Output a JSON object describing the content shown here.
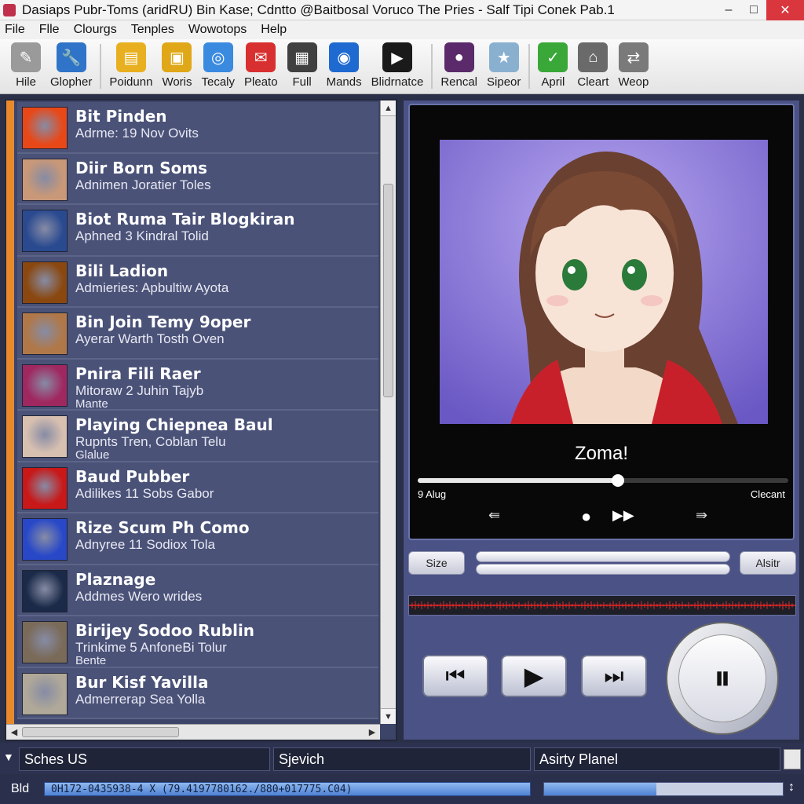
{
  "window": {
    "title": "Dasiaps Pubr-Toms (aridRU) Bin Kase; Cdntto @Baitbosal Voruco The Pries - Salf Tipi Conek Pab.1",
    "minimize_glyph": "–",
    "maximize_glyph": "□",
    "close_glyph": "✕"
  },
  "menu": [
    "File",
    "Flle",
    "Clourgs",
    "Tenples",
    "Wowotops",
    "Help"
  ],
  "toolbar": [
    {
      "label": "Hile",
      "icon": "satellite-icon",
      "color": "#9a9a9a",
      "glyph": "✎"
    },
    {
      "label": "Glopher",
      "icon": "wrench-icon",
      "color": "#2f74c8",
      "glyph": "🔧"
    },
    {
      "label": "Poidunn",
      "icon": "document-icon",
      "color": "#e8b020",
      "glyph": "▤"
    },
    {
      "label": "Woris",
      "icon": "folder-icon",
      "color": "#e0a818",
      "glyph": "▣"
    },
    {
      "label": "Tecaly",
      "icon": "compass-icon",
      "color": "#3a8ae0",
      "glyph": "◎"
    },
    {
      "label": "Pleato",
      "icon": "mail-icon",
      "color": "#d83030",
      "glyph": "✉"
    },
    {
      "label": "Full",
      "icon": "film-icon",
      "color": "#404040",
      "glyph": "▦"
    },
    {
      "label": "Mands",
      "icon": "globe-icon",
      "color": "#1e6ad0",
      "glyph": "◉"
    },
    {
      "label": "Blidrnatce",
      "icon": "play-store-icon",
      "color": "#1a1a1a",
      "glyph": "▶"
    },
    {
      "label": "Rencal",
      "icon": "disc-icon",
      "color": "#5a2a6a",
      "glyph": "●"
    },
    {
      "label": "Sipeor",
      "icon": "badge-icon",
      "color": "#8ab0d0",
      "glyph": "★"
    },
    {
      "label": "April",
      "icon": "check-icon",
      "color": "#3aa838",
      "glyph": "✓"
    },
    {
      "label": "Cleart",
      "icon": "home-icon",
      "color": "#6a6a6a",
      "glyph": "⌂"
    },
    {
      "label": "Weop",
      "icon": "swap-icon",
      "color": "#7a7a7a",
      "glyph": "⇄"
    }
  ],
  "playlist": [
    {
      "title": "Bit Pinden",
      "sub": "Adrme: 19 Nov Ovits",
      "sub2": "",
      "thumb": "#e84818"
    },
    {
      "title": "Diir Born Soms",
      "sub": "Adnimen Joratier Toles",
      "sub2": "",
      "thumb": "#c89878"
    },
    {
      "title": "Biot Ruma Tair Blogkiran",
      "sub": "Aphned 3 Kindral Tolid",
      "sub2": "",
      "thumb": "#2a4a90"
    },
    {
      "title": "Bili Ladion",
      "sub": "Admieries: Apbultiw Ayota",
      "sub2": "",
      "thumb": "#8a4810"
    },
    {
      "title": "Bin Join Temy 9oper",
      "sub": "Ayerar Warth Tosth Oven",
      "sub2": "",
      "thumb": "#b07848"
    },
    {
      "title": "Pnira Fili Raer",
      "sub": "Mitoraw 2 Juhin Tajyb",
      "sub2": "Mante",
      "thumb": "#a02860"
    },
    {
      "title": "Playing Chiepnea Baul",
      "sub": "Rupnts Tren, Coblan Telu",
      "sub2": "Glalue",
      "thumb": "#d8c0b0"
    },
    {
      "title": "Baud Pubber",
      "sub": "Adilikes 11 Sobs Gabor",
      "sub2": "",
      "thumb": "#c81818"
    },
    {
      "title": "Rize Scum Ph Como",
      "sub": "Adnyree 11 Sodiox Tola",
      "sub2": "",
      "thumb": "#2848c8"
    },
    {
      "title": "Plaznage",
      "sub": "Addmes Wero wrides",
      "sub2": "",
      "thumb": "#1a2a48"
    },
    {
      "title": "Birijey Sodoo Rublin",
      "sub": "Trinkime 5 AnfoneBi Tolur",
      "sub2": "Bente",
      "thumb": "#7a6a58"
    },
    {
      "title": "Bur Kisf Yavilla",
      "sub": "Admerrerap Sea Yolla",
      "sub2": "",
      "thumb": "#b0a898"
    }
  ],
  "player": {
    "track_title": "Zoma!",
    "time_elapsed": "9 Alug",
    "time_right": "Clecant",
    "progress": 0.54,
    "size_label": "Size",
    "alt_label": "Alsitr",
    "prev_glyph": "⏮",
    "play_glyph": "▶",
    "next_glyph": "⏭",
    "pause_glyph": "⏸"
  },
  "status": {
    "field1": "Sches US",
    "field2": "Sjevich",
    "field3": "Asirty Planel",
    "left_label": "Bld",
    "coords": "0H172-0435938-4 X (79.4197780162./880+017775.C04)",
    "progress": 0.47
  }
}
